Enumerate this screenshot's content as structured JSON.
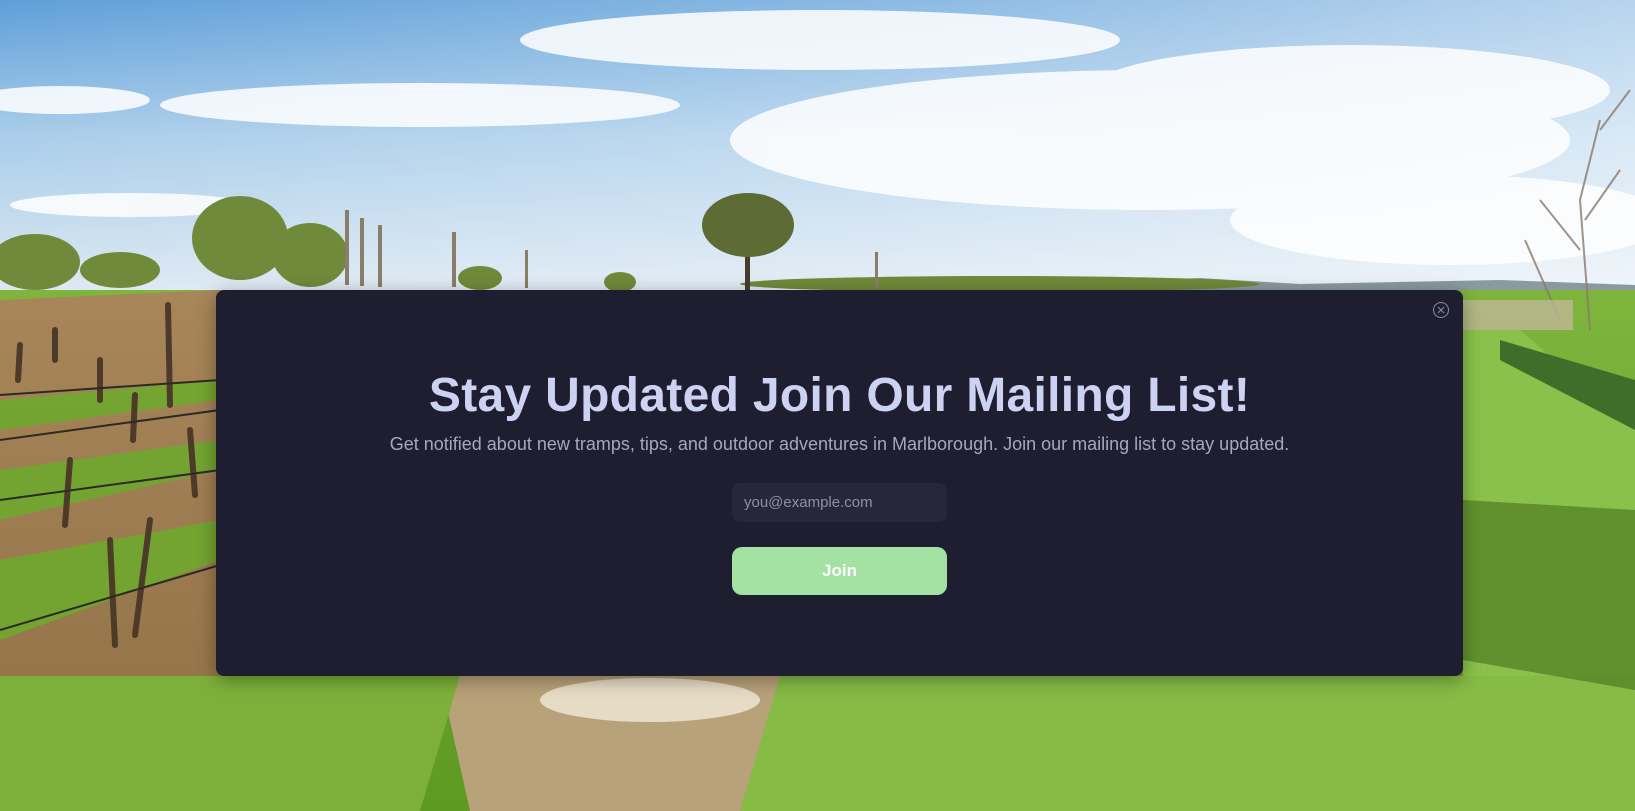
{
  "modal": {
    "title": "Stay Updated Join Our Mailing List!",
    "subtitle": "Get notified about new tramps, tips, and outdoor adventures in Marlborough. Join our mailing list to stay updated.",
    "email_placeholder": "you@example.com",
    "email_value": "",
    "join_label": "Join"
  },
  "icons": {
    "close": "close-icon"
  },
  "colors": {
    "modal_background": "#1f1e30",
    "title": "#cdd2f3",
    "subtitle": "#a4a8bf",
    "input_background": "#27273a",
    "join_button": "#a3e2a2",
    "join_text": "#ffffff"
  }
}
